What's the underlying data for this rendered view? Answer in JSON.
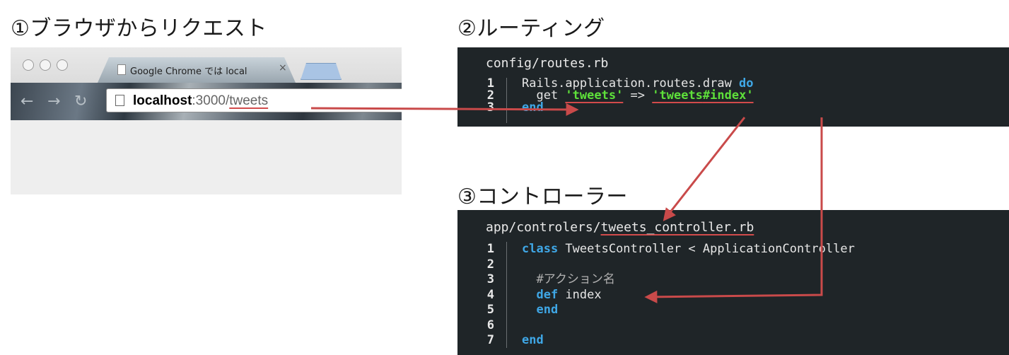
{
  "steps": {
    "step1": "①ブラウザからリクエスト",
    "step2": "②ルーティング",
    "step3": "③コントローラー"
  },
  "browser": {
    "tab_title": "Google Chrome では local",
    "tab_close": "×",
    "url_host": "localhost",
    "url_port": ":3000/",
    "url_path": "tweets"
  },
  "routes": {
    "filename": "config/routes.rb",
    "lines": [
      {
        "num": "1",
        "parts": [
          {
            "t": "Rails.application.routes.draw ",
            "c": ""
          },
          {
            "t": "do",
            "c": "kw"
          }
        ]
      },
      {
        "num": "2",
        "parts": [
          {
            "t": "  get ",
            "c": ""
          },
          {
            "t": "'tweets'",
            "c": "str ul"
          },
          {
            "t": " => ",
            "c": ""
          },
          {
            "t": "'tweets",
            "c": "str ul"
          },
          {
            "t": "#index'",
            "c": "str ul"
          }
        ]
      },
      {
        "num": "3",
        "parts": [
          {
            "t": "end",
            "c": "kw"
          }
        ]
      }
    ]
  },
  "controller": {
    "filename_prefix": "app/controlers/",
    "filename_main": "tweets_controller.rb",
    "lines": [
      {
        "num": "1",
        "parts": [
          {
            "t": "class",
            "c": "kw"
          },
          {
            "t": " TweetsController < ApplicationController",
            "c": ""
          }
        ]
      },
      {
        "num": "2",
        "parts": []
      },
      {
        "num": "3",
        "parts": [
          {
            "t": "  #アクション名",
            "c": "cm"
          }
        ]
      },
      {
        "num": "4",
        "parts": [
          {
            "t": "  ",
            "c": ""
          },
          {
            "t": "def",
            "c": "kw"
          },
          {
            "t": " index",
            "c": ""
          }
        ]
      },
      {
        "num": "5",
        "parts": [
          {
            "t": "  ",
            "c": ""
          },
          {
            "t": "end",
            "c": "kw"
          }
        ]
      },
      {
        "num": "6",
        "parts": []
      },
      {
        "num": "7",
        "parts": [
          {
            "t": "end",
            "c": "kw"
          }
        ]
      }
    ]
  },
  "colors": {
    "arrow": "#c94a4a",
    "code_bg": "#1f2528",
    "keyword": "#3fa7e6",
    "string": "#5ee03a"
  }
}
